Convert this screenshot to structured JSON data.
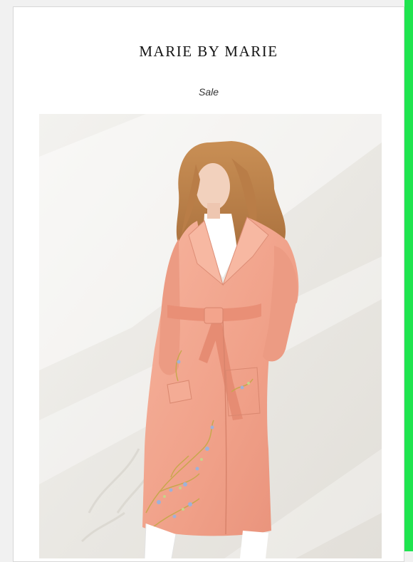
{
  "email": {
    "brand": "MARIE BY MARIE",
    "subtitle": "Sale"
  },
  "hero_image": {
    "alt": "Model wearing a peach belted wool coat with floral embroidery"
  },
  "colors": {
    "accent_bar": "#1fe44f",
    "coat": "#f2a58e",
    "card_background": "#ffffff"
  }
}
